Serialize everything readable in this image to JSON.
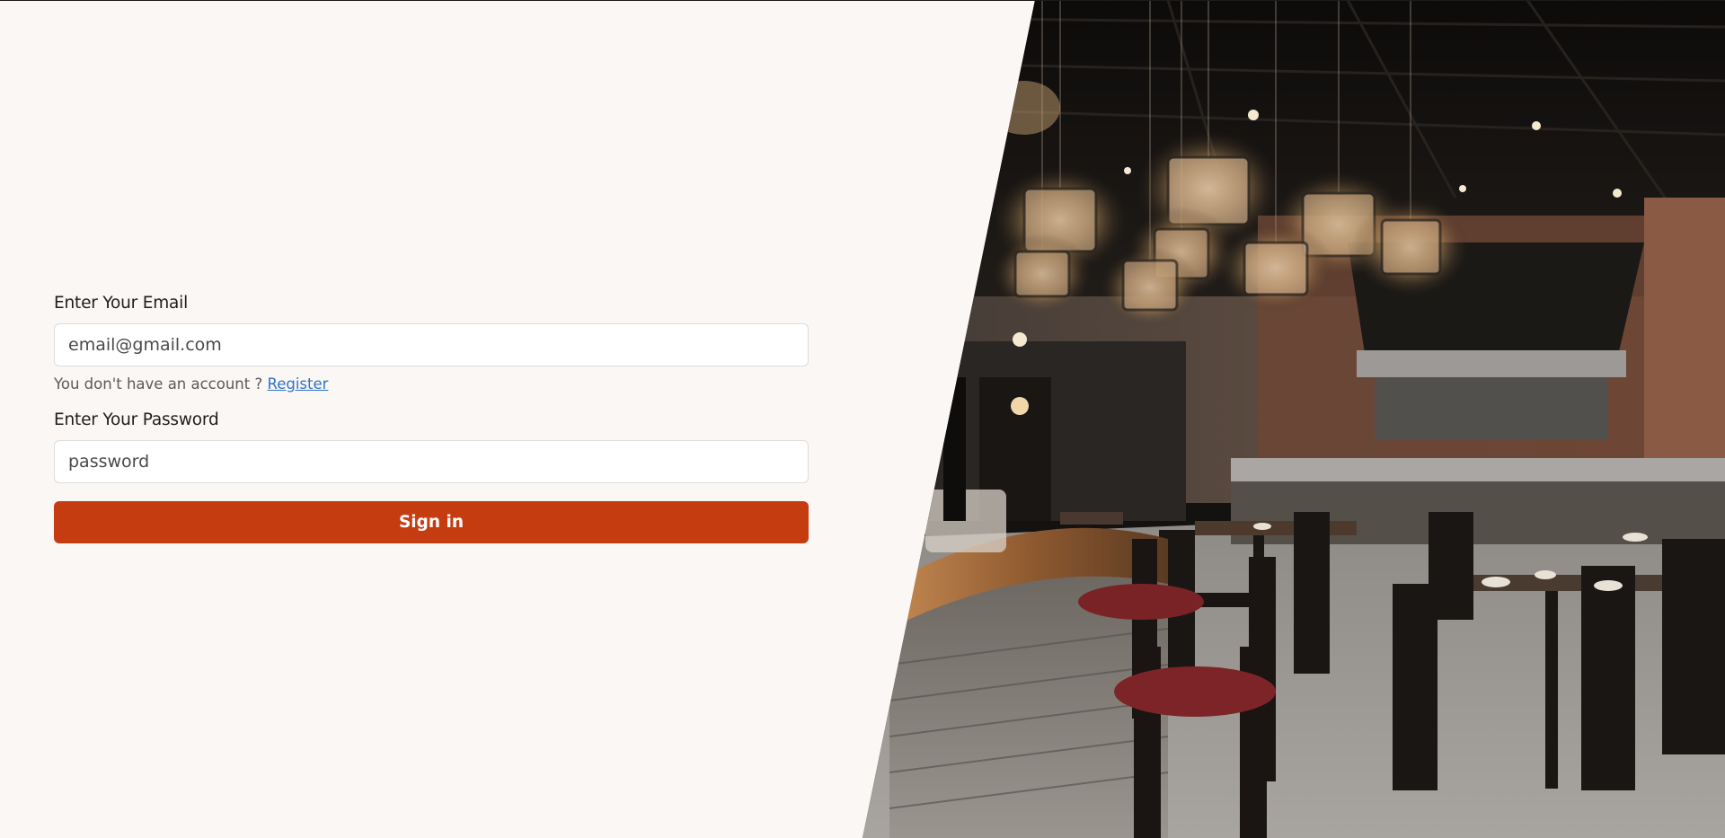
{
  "colors": {
    "page_background": "#fbf7f4",
    "accent": "#c63c11",
    "link": "#2f73c9"
  },
  "form": {
    "email_label": "Enter Your Email",
    "email_placeholder": "email@gmail.com",
    "email_value": "",
    "hint_text": "You don't have an account ?",
    "register_link": "Register",
    "password_label": "Enter Your Password",
    "password_placeholder": "password",
    "password_value": "",
    "signin_label": "Sign in"
  },
  "hero": {
    "image_subject": "restaurant-interior-photo"
  }
}
